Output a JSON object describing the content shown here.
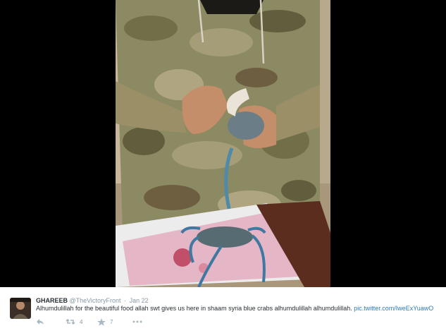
{
  "tweet": {
    "display_name": "GHAREEB",
    "handle": "@TheVictoryFront",
    "separator": "·",
    "timestamp": "Jan 22",
    "text": "Alhumdulillah for the beautiful food allah swt gives us here in shaam syria blue crabs alhumdulillah alhumdulillah.",
    "link": "pic.twitter.com/IweExYuawO",
    "actions": {
      "reply_icon": "reply-icon",
      "retweet_icon": "retweet-icon",
      "retweet_count": "4",
      "favorite_icon": "star-icon",
      "favorite_count": "7",
      "more_icon": "more-dots-icon"
    }
  },
  "colors": {
    "text": "#292f33",
    "secondary_text": "#8899a6",
    "link": "#2b7bb9",
    "background": "#000000"
  }
}
